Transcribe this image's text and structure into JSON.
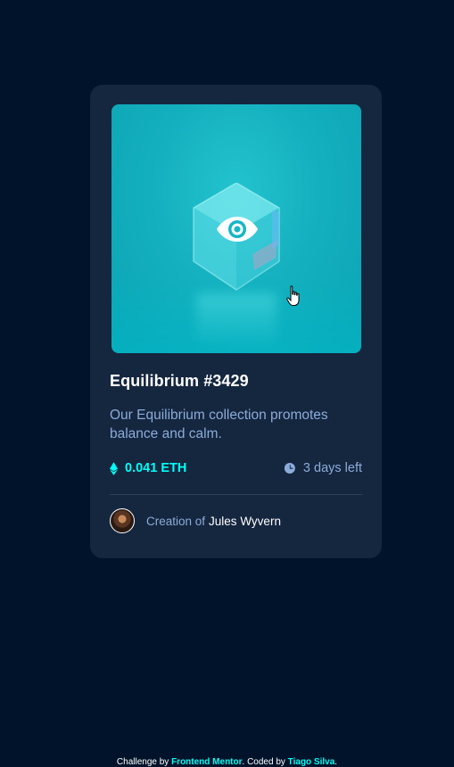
{
  "card": {
    "title": "Equilibrium #3429",
    "description": "Our Equilibrium collection promotes balance and calm.",
    "price": "0.041 ETH",
    "time_left": "3 days left",
    "creator_prefix": "Creation of",
    "creator_name": "Jules Wyvern"
  },
  "icons": {
    "price": "ethereum-icon",
    "time": "clock-icon",
    "hover": "view-eye-icon",
    "pointer": "hand-cursor-icon"
  },
  "attribution": {
    "prefix": "Challenge by",
    "challenge_link": "Frontend Mentor",
    "middle": ". Coded by",
    "author_link": "Tiago Silva",
    "suffix": "."
  },
  "colors": {
    "page_background": "#01132a",
    "card_background": "#15263f",
    "accent_cyan": "#00fff8",
    "soft_blue": "#8bacd9",
    "white": "#ffffff"
  }
}
